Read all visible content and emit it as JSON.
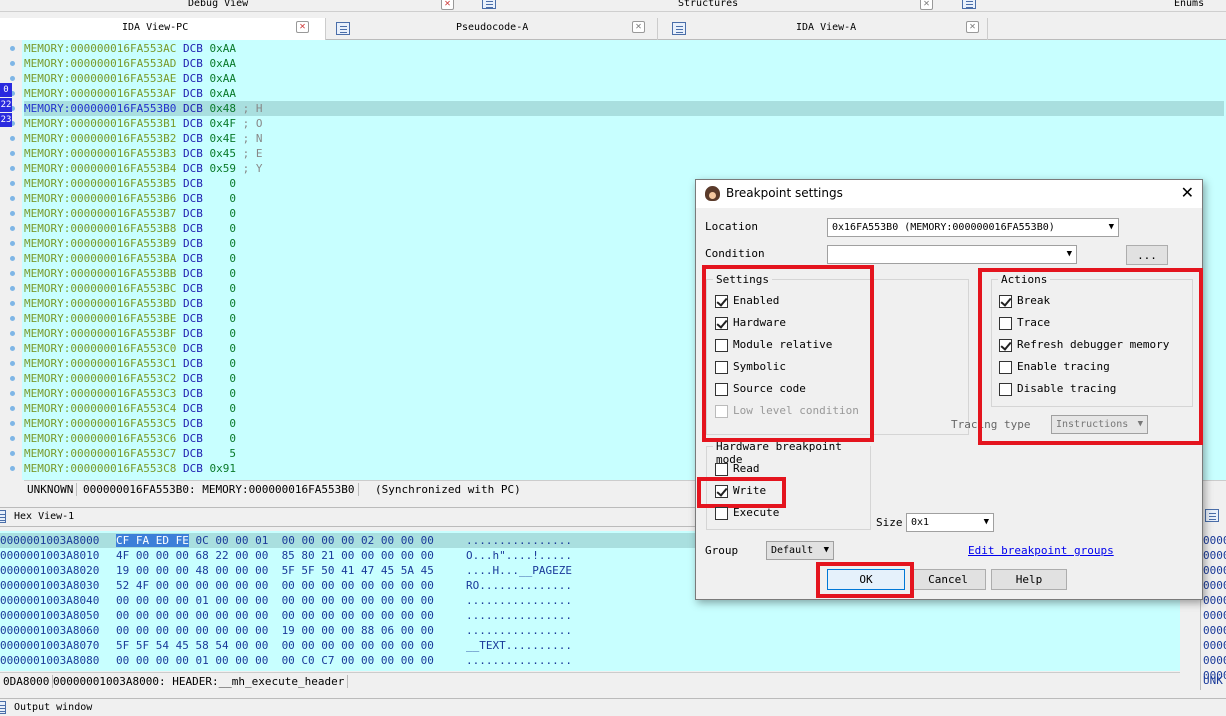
{
  "top_tabs": {
    "debug_view": "Debug View",
    "structures": "Structures",
    "enums": "Enums"
  },
  "tabs": [
    {
      "label": "IDA View-PC",
      "active": true
    },
    {
      "label": "Pseudocode-A",
      "active": false
    },
    {
      "label": "IDA View-A",
      "active": false
    }
  ],
  "ida_view": {
    "gutter_numbers": [
      "0",
      "22",
      "23"
    ],
    "rows": [
      {
        "addr": "MEMORY:000000016FA553AC",
        "op": "DCB",
        "val": "0xAA",
        "cmt": "",
        "hl": false
      },
      {
        "addr": "MEMORY:000000016FA553AD",
        "op": "DCB",
        "val": "0xAA",
        "cmt": "",
        "hl": false
      },
      {
        "addr": "MEMORY:000000016FA553AE",
        "op": "DCB",
        "val": "0xAA",
        "cmt": "",
        "hl": false
      },
      {
        "addr": "MEMORY:000000016FA553AF",
        "op": "DCB",
        "val": "0xAA",
        "cmt": "",
        "hl": false
      },
      {
        "addr": "MEMORY:000000016FA553B0",
        "op": "DCB",
        "val": "0x48",
        "cmt": "; H",
        "hl": true
      },
      {
        "addr": "MEMORY:000000016FA553B1",
        "op": "DCB",
        "val": "0x4F",
        "cmt": "; O",
        "hl": false
      },
      {
        "addr": "MEMORY:000000016FA553B2",
        "op": "DCB",
        "val": "0x4E",
        "cmt": "; N",
        "hl": false
      },
      {
        "addr": "MEMORY:000000016FA553B3",
        "op": "DCB",
        "val": "0x45",
        "cmt": "; E",
        "hl": false
      },
      {
        "addr": "MEMORY:000000016FA553B4",
        "op": "DCB",
        "val": "0x59",
        "cmt": "; Y",
        "hl": false
      },
      {
        "addr": "MEMORY:000000016FA553B5",
        "op": "DCB",
        "val": "   0",
        "cmt": "",
        "hl": false
      },
      {
        "addr": "MEMORY:000000016FA553B6",
        "op": "DCB",
        "val": "   0",
        "cmt": "",
        "hl": false
      },
      {
        "addr": "MEMORY:000000016FA553B7",
        "op": "DCB",
        "val": "   0",
        "cmt": "",
        "hl": false
      },
      {
        "addr": "MEMORY:000000016FA553B8",
        "op": "DCB",
        "val": "   0",
        "cmt": "",
        "hl": false
      },
      {
        "addr": "MEMORY:000000016FA553B9",
        "op": "DCB",
        "val": "   0",
        "cmt": "",
        "hl": false
      },
      {
        "addr": "MEMORY:000000016FA553BA",
        "op": "DCB",
        "val": "   0",
        "cmt": "",
        "hl": false
      },
      {
        "addr": "MEMORY:000000016FA553BB",
        "op": "DCB",
        "val": "   0",
        "cmt": "",
        "hl": false
      },
      {
        "addr": "MEMORY:000000016FA553BC",
        "op": "DCB",
        "val": "   0",
        "cmt": "",
        "hl": false
      },
      {
        "addr": "MEMORY:000000016FA553BD",
        "op": "DCB",
        "val": "   0",
        "cmt": "",
        "hl": false
      },
      {
        "addr": "MEMORY:000000016FA553BE",
        "op": "DCB",
        "val": "   0",
        "cmt": "",
        "hl": false
      },
      {
        "addr": "MEMORY:000000016FA553BF",
        "op": "DCB",
        "val": "   0",
        "cmt": "",
        "hl": false
      },
      {
        "addr": "MEMORY:000000016FA553C0",
        "op": "DCB",
        "val": "   0",
        "cmt": "",
        "hl": false
      },
      {
        "addr": "MEMORY:000000016FA553C1",
        "op": "DCB",
        "val": "   0",
        "cmt": "",
        "hl": false
      },
      {
        "addr": "MEMORY:000000016FA553C2",
        "op": "DCB",
        "val": "   0",
        "cmt": "",
        "hl": false
      },
      {
        "addr": "MEMORY:000000016FA553C3",
        "op": "DCB",
        "val": "   0",
        "cmt": "",
        "hl": false
      },
      {
        "addr": "MEMORY:000000016FA553C4",
        "op": "DCB",
        "val": "   0",
        "cmt": "",
        "hl": false
      },
      {
        "addr": "MEMORY:000000016FA553C5",
        "op": "DCB",
        "val": "   0",
        "cmt": "",
        "hl": false
      },
      {
        "addr": "MEMORY:000000016FA553C6",
        "op": "DCB",
        "val": "   0",
        "cmt": "",
        "hl": false
      },
      {
        "addr": "MEMORY:000000016FA553C7",
        "op": "DCB",
        "val": "   5",
        "cmt": "",
        "hl": false
      },
      {
        "addr": "MEMORY:000000016FA553C8",
        "op": "DCB",
        "val": "0x91",
        "cmt": "",
        "hl": false
      }
    ],
    "status": {
      "mode": "UNKNOWN",
      "location": "000000016FA553B0: MEMORY:000000016FA553B0",
      "sync": "(Synchronized with PC)"
    }
  },
  "hex_view": {
    "title": "Hex View-1",
    "rows": [
      {
        "addr": "0000001003A8000",
        "sel": "CF FA ED FE",
        "bytes": " 0C 00 00 01  00 00 00 00 02 00 00 00",
        "ascii": "................"
      },
      {
        "addr": "0000001003A8010",
        "sel": "",
        "bytes": "4F 00 00 00 68 22 00 00  85 80 21 00 00 00 00 00",
        "ascii": "O...h\"....!....."
      },
      {
        "addr": "0000001003A8020",
        "sel": "",
        "bytes": "19 00 00 00 48 00 00 00  5F 5F 50 41 47 45 5A 45",
        "ascii": "....H...__PAGEZE"
      },
      {
        "addr": "0000001003A8030",
        "sel": "",
        "bytes": "52 4F 00 00 00 00 00 00  00 00 00 00 00 00 00 00",
        "ascii": "RO.............."
      },
      {
        "addr": "0000001003A8040",
        "sel": "",
        "bytes": "00 00 00 00 01 00 00 00  00 00 00 00 00 00 00 00",
        "ascii": "................"
      },
      {
        "addr": "0000001003A8050",
        "sel": "",
        "bytes": "00 00 00 00 00 00 00 00  00 00 00 00 00 00 00 00",
        "ascii": "................"
      },
      {
        "addr": "0000001003A8060",
        "sel": "",
        "bytes": "00 00 00 00 00 00 00 00  19 00 00 00 88 06 00 00",
        "ascii": "................"
      },
      {
        "addr": "0000001003A8070",
        "sel": "",
        "bytes": "5F 5F 54 45 58 54 00 00  00 00 00 00 00 00 00 00",
        "ascii": "__TEXT.........."
      },
      {
        "addr": "0000001003A8080",
        "sel": "",
        "bytes": "00 00 00 00 01 00 00 00  00 C0 C7 00 00 00 00 00",
        "ascii": "................"
      }
    ],
    "status": {
      "left": "0DA8000",
      "right": "00000001003A8000: HEADER:__mh_execute_header"
    },
    "right_cells": [
      "0000",
      "0000",
      "0000",
      "0000",
      "0000",
      "0000",
      "0000",
      "0000",
      "0000",
      "0000"
    ],
    "right_status": "UNK"
  },
  "output_window": {
    "title": "Output window"
  },
  "dialog": {
    "title": "Breakpoint settings",
    "location_label": "Location",
    "location_value": "0x16FA553B0 (MEMORY:000000016FA553B0)",
    "condition_label": "Condition",
    "condition_value": "",
    "ellipsis_btn": "...",
    "settings": {
      "title": "Settings",
      "items": [
        {
          "label": "Enabled",
          "checked": true,
          "disabled": false
        },
        {
          "label": "Hardware",
          "checked": true,
          "disabled": false
        },
        {
          "label": "Module relative",
          "checked": false,
          "disabled": false
        },
        {
          "label": "Symbolic",
          "checked": false,
          "disabled": false
        },
        {
          "label": "Source code",
          "checked": false,
          "disabled": false
        },
        {
          "label": "Low level condition",
          "checked": false,
          "disabled": true
        }
      ]
    },
    "actions": {
      "title": "Actions",
      "items": [
        {
          "label": "Break",
          "checked": true,
          "disabled": false
        },
        {
          "label": "Trace",
          "checked": false,
          "disabled": false
        },
        {
          "label": "Refresh debugger memory",
          "checked": true,
          "disabled": false
        },
        {
          "label": "Enable tracing",
          "checked": false,
          "disabled": false
        },
        {
          "label": "Disable tracing",
          "checked": false,
          "disabled": false
        }
      ]
    },
    "tracing_type_label": "Tracing type",
    "tracing_type_value": "Instructions",
    "hw_mode": {
      "title": "Hardware breakpoint mode",
      "items": [
        {
          "label": "Read",
          "checked": false
        },
        {
          "label": "Write",
          "checked": true
        },
        {
          "label": "Execute",
          "checked": false
        }
      ]
    },
    "size_label": "Size",
    "size_value": "0x1",
    "group_label": "Group",
    "group_value": "Default",
    "edit_groups_link": "Edit breakpoint groups",
    "ok": "OK",
    "cancel": "Cancel",
    "help": "Help"
  },
  "colors": {
    "ida_bg": "#c8ffff",
    "highlight_red": "#e4141e",
    "selection_blue": "#3c7fd8"
  }
}
